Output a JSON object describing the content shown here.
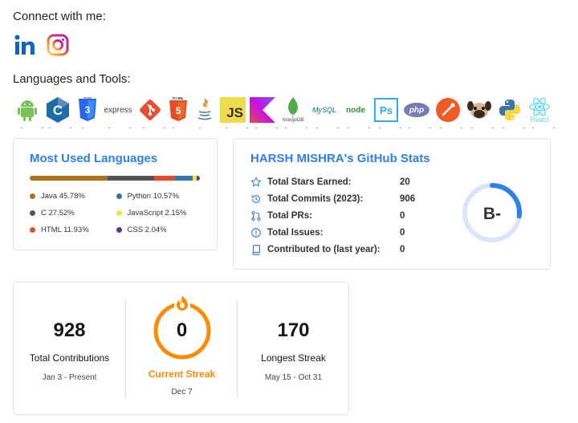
{
  "connect_heading": "Connect with me:",
  "social": [
    {
      "name": "linkedin-icon",
      "glyph": "in",
      "color": "#0a66c2"
    },
    {
      "name": "instagram-icon",
      "color": "#e1306c"
    }
  ],
  "tools_heading": "Languages and Tools:",
  "tools": [
    {
      "name": "android-icon",
      "color": "#78c257"
    },
    {
      "name": "c-icon",
      "color": "#1d6ba8"
    },
    {
      "name": "css3-icon",
      "color": "#2965f1"
    },
    {
      "name": "express-icon",
      "text": "express",
      "color": "#444444"
    },
    {
      "name": "git-icon",
      "color": "#e84d31"
    },
    {
      "name": "html5-icon",
      "color": "#e44d26"
    },
    {
      "name": "java-icon",
      "color": "#e76f00"
    },
    {
      "name": "javascript-icon",
      "text": "JS",
      "color": "#f0db4f"
    },
    {
      "name": "kotlin-icon",
      "color": "#7f52ff"
    },
    {
      "name": "mongodb-icon",
      "text": "mongoDB",
      "color": "#4fa94d"
    },
    {
      "name": "mysql-icon",
      "text": "MySQL",
      "color": "#00758f"
    },
    {
      "name": "nodejs-icon",
      "text": "node",
      "color": "#3c873a"
    },
    {
      "name": "photoshop-icon",
      "text": "Ps",
      "color": "#31a8ff"
    },
    {
      "name": "php-icon",
      "text": "php",
      "color": "#777bb3"
    },
    {
      "name": "postman-icon",
      "color": "#ef5b25"
    },
    {
      "name": "pug-icon",
      "color": "#b78a5c"
    },
    {
      "name": "python-icon",
      "color": "#3776ab"
    },
    {
      "name": "react-icon",
      "text": "React",
      "color": "#61dafb"
    }
  ],
  "languages_card": {
    "title": "Most Used Languages",
    "languages": [
      {
        "name": "Java",
        "percent": 45.78,
        "label": "Java 45.78%",
        "color": "#b07219"
      },
      {
        "name": "Python",
        "percent": 10.57,
        "label": "Python 10.57%",
        "color": "#3572a5"
      },
      {
        "name": "C",
        "percent": 27.52,
        "label": "C 27.52%",
        "color": "#555555"
      },
      {
        "name": "JavaScript",
        "percent": 2.15,
        "label": "JavaScript 2.15%",
        "color": "#f1e05a"
      },
      {
        "name": "HTML",
        "percent": 11.93,
        "label": "HTML 11.93%",
        "color": "#e34c26"
      },
      {
        "name": "CSS",
        "percent": 2.04,
        "label": "CSS 2.04%",
        "color": "#563d7c"
      }
    ],
    "bar_order": [
      "Java",
      "C",
      "HTML",
      "Python",
      "JavaScript",
      "CSS"
    ]
  },
  "stats_card": {
    "title": "HARSH MISHRA's GitHub Stats",
    "rows": [
      {
        "icon": "star-icon",
        "label": "Total Stars Earned:",
        "value": "20"
      },
      {
        "icon": "history-icon",
        "label": "Total Commits (2023):",
        "value": "906"
      },
      {
        "icon": "pull-request-icon",
        "label": "Total PRs:",
        "value": "0"
      },
      {
        "icon": "issue-icon",
        "label": "Total Issues:",
        "value": "0"
      },
      {
        "icon": "repo-icon",
        "label": "Contributed to (last year):",
        "value": "0"
      }
    ],
    "rank": "B-",
    "rank_progress": 0.27,
    "accent": "#2f80ed"
  },
  "streak_card": {
    "total_contributions": {
      "value": "928",
      "label": "Total Contributions",
      "range": "Jan 3 - Present"
    },
    "current_streak": {
      "value": "0",
      "label": "Current Streak",
      "date": "Dec 7"
    },
    "longest_streak": {
      "value": "170",
      "label": "Longest Streak",
      "range": "May 15 - Oct 31"
    },
    "ring_color": "#fb8c00"
  }
}
